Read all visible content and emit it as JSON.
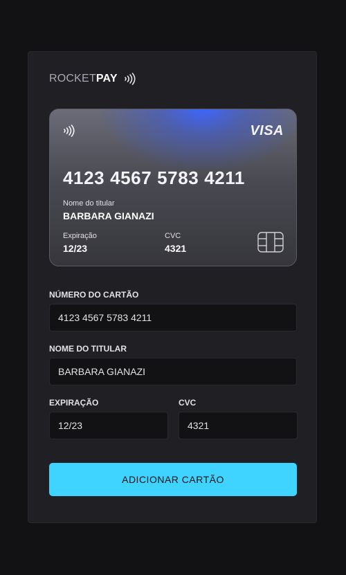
{
  "brand": {
    "name_light": "ROCKET",
    "name_bold": "PAY"
  },
  "card": {
    "network": "VISA",
    "number": "4123 4567 5783 4211",
    "holder_label": "Nome do titular",
    "holder_name": "BARBARA GIANAZI",
    "expiration_label": "Expiração",
    "expiration_value": "12/23",
    "cvc_label": "CVC",
    "cvc_value": "4321"
  },
  "form": {
    "number_label": "NÚMERO DO CARTÃO",
    "number_value": "4123 4567 5783 4211",
    "holder_label": "NOME DO TITULAR",
    "holder_value": "BARBARA GIANAZI",
    "expiration_label": "EXPIRAÇÃO",
    "expiration_value": "12/23",
    "cvc_label": "CVC",
    "cvc_value": "4321",
    "submit_label": "ADICIONAR CARTÃO"
  },
  "colors": {
    "background": "#121214",
    "panel": "#202024",
    "accent": "#3fd3ff"
  },
  "icons": [
    "contactless-icon",
    "visa-logo",
    "chip-icon"
  ]
}
